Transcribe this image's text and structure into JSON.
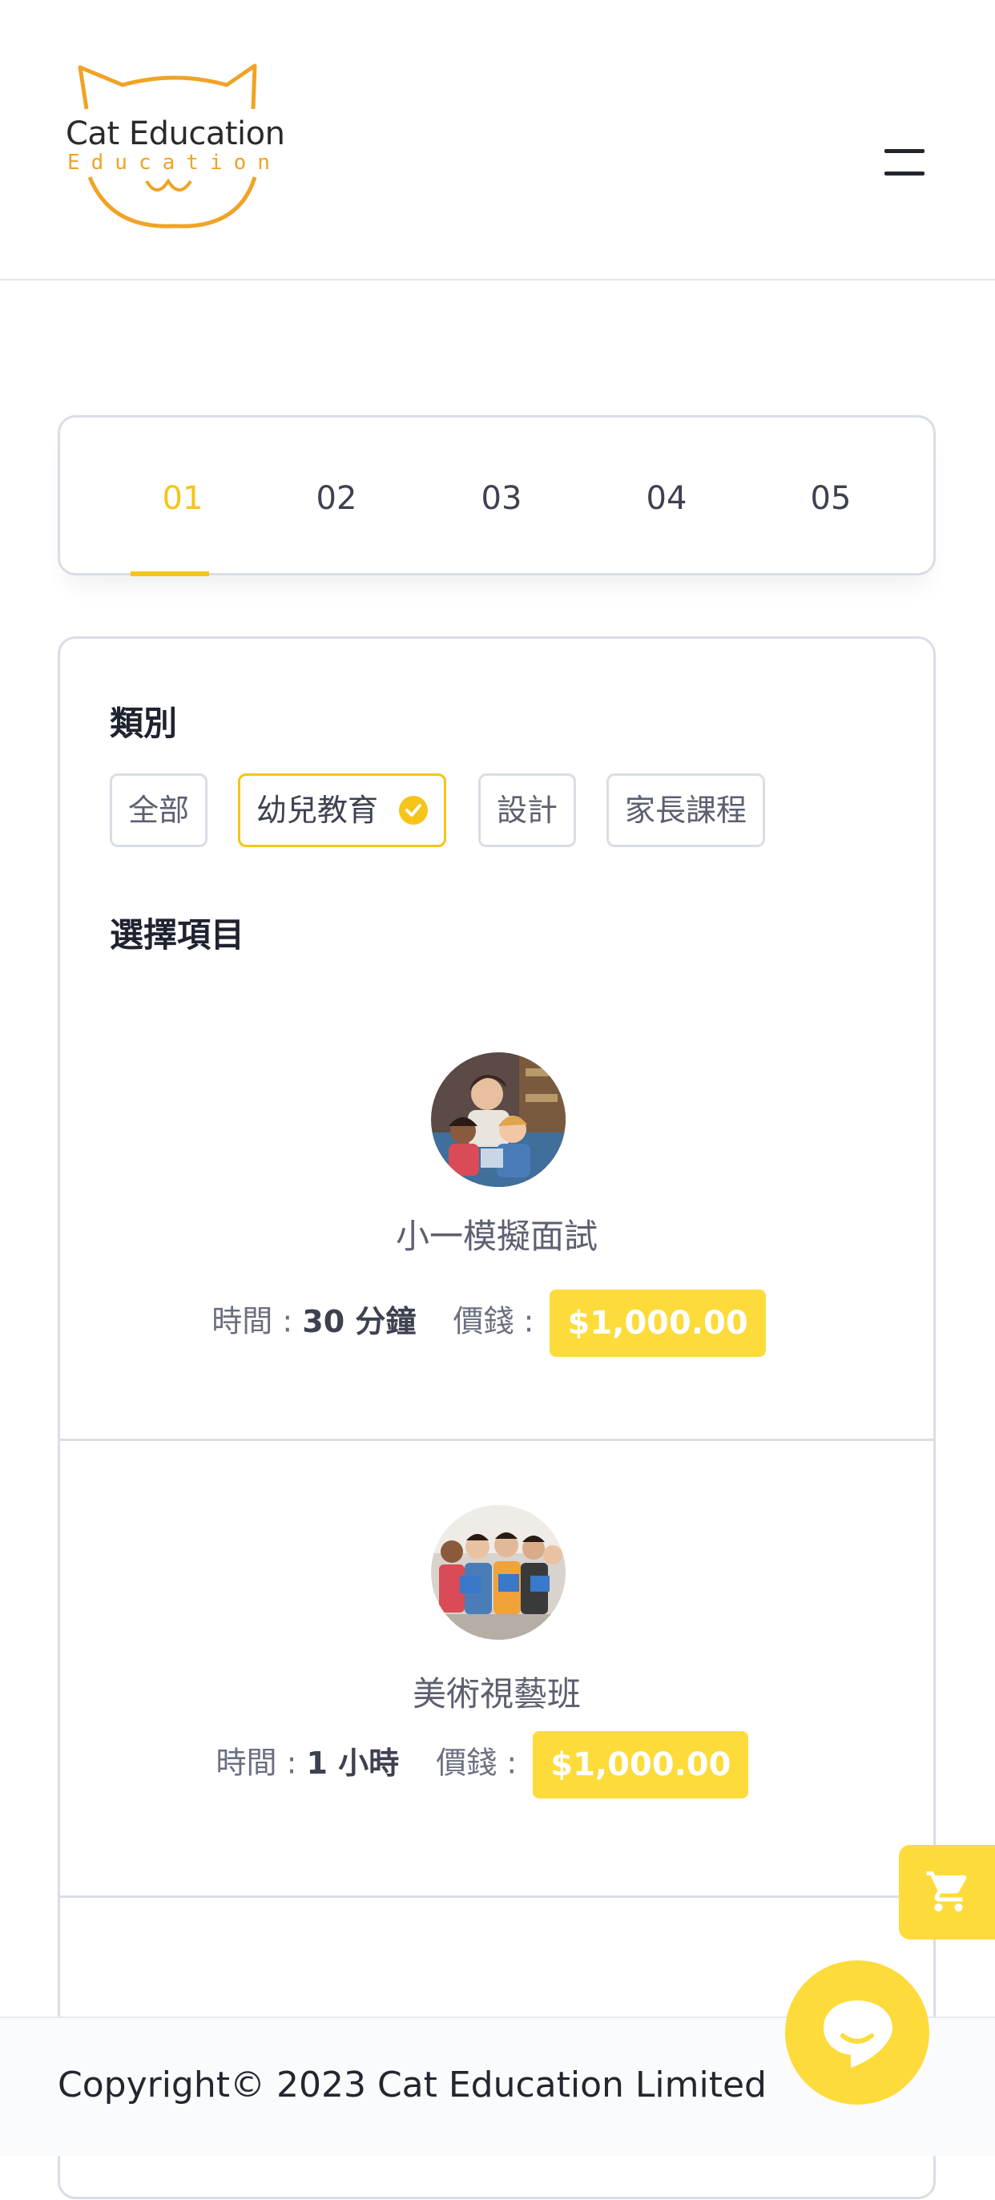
{
  "header": {
    "logo_text": "Cat Education",
    "logo_subtext": "Education",
    "menu_icon": "hamburger-icon"
  },
  "steps": {
    "items": [
      "01",
      "02",
      "03",
      "04",
      "05"
    ],
    "active_index": 0
  },
  "categories": {
    "title": "類別",
    "chips": [
      {
        "label": "全部",
        "selected": false
      },
      {
        "label": "幼兒教育",
        "selected": true
      },
      {
        "label": "設計",
        "selected": false
      },
      {
        "label": "家長課程",
        "selected": false
      }
    ]
  },
  "selection": {
    "title": "選擇項目",
    "items": [
      {
        "name": "小一模擬面試",
        "time_label": "時間 :",
        "time_value": "30 分鐘",
        "price_label": "價錢 :",
        "price": "$1,000.00"
      },
      {
        "name": "美術視藝班",
        "time_label": "時間 :",
        "time_value": "1 小時",
        "price_label": "價錢 :",
        "price": "$1,000.00"
      }
    ]
  },
  "footer": {
    "copyright": "Copyright© 2023 Cat Education Limited"
  },
  "floating": {
    "cart_icon": "cart-icon",
    "chat_icon": "chat-bubble-icon"
  },
  "colors": {
    "accent": "#f5c518",
    "price_bg": "#fddb3a",
    "logo_orange": "#f0a326",
    "border": "#d9dde6"
  }
}
